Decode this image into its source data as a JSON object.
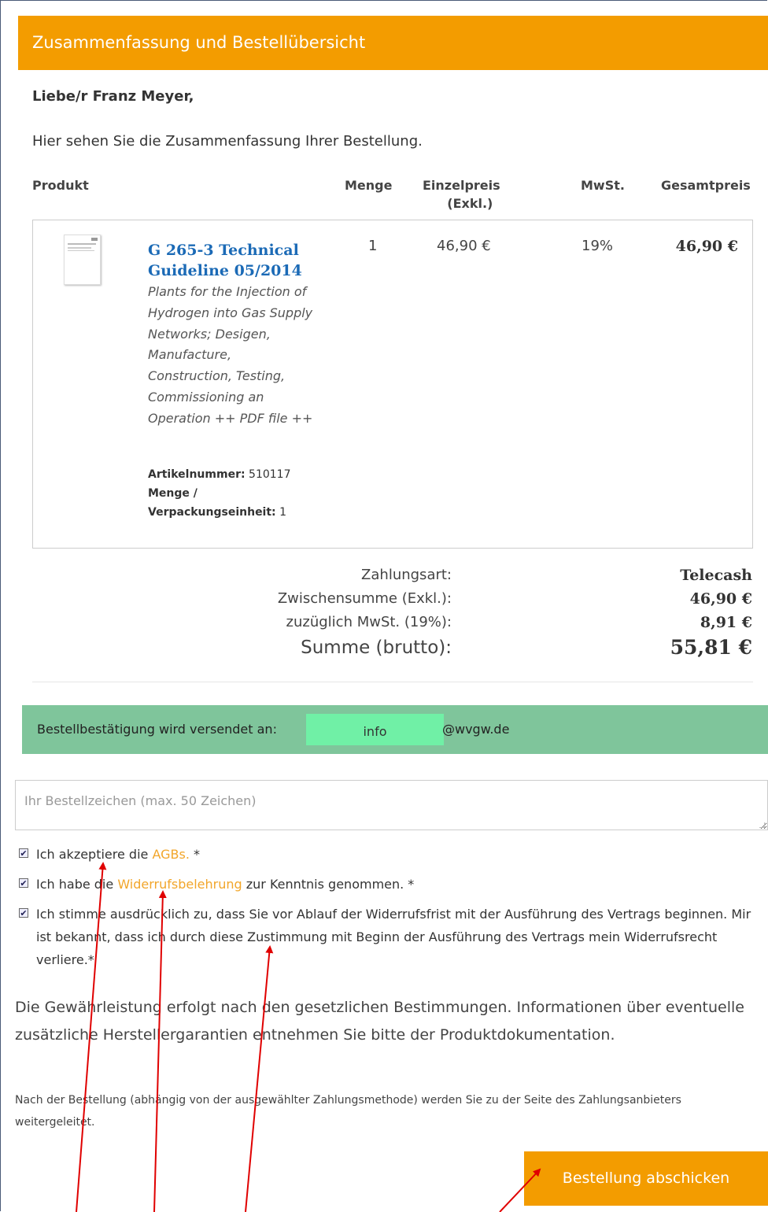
{
  "header": {
    "title": "Zusammenfassung und Bestellübersicht"
  },
  "greeting": "Liebe/r Franz Meyer,",
  "intro": "Hier sehen Sie die Zusammenfassung Ihrer Bestellung.",
  "table": {
    "col_product": "Produkt",
    "col_qty": "Menge",
    "col_unit": "Einzelpreis",
    "col_unit_sub": "(Exkl.)",
    "col_vat": "MwSt.",
    "col_total": "Gesamtpreis"
  },
  "item": {
    "name": "G 265-3 Technical Guideline 05/2014",
    "description": "Plants for the Injection of Hydrogen into Gas Supply Networks; Desigen, Manufacture, Construction, Testing, Commissioning an Operation ++ PDF file ++",
    "article_label": "Artikelnummer:",
    "article_value": "510117",
    "pack_label": "Menge / Verpackungseinheit:",
    "pack_value": "1",
    "qty": "1",
    "unit_price": "46,90 €",
    "vat": "19%",
    "total": "46,90 €"
  },
  "summary": {
    "payment_label": "Zahlungsart:",
    "payment_value": "Telecash",
    "subtotal_label": "Zwischensumme (Exkl.):",
    "subtotal_value": "46,90 €",
    "vat_label": "zuzüglich MwSt. (19%):",
    "vat_value": "8,91 €",
    "gross_label": "Summe (brutto):",
    "gross_value": "55,81 €"
  },
  "confirmation": {
    "label": "Bestellbestätigung wird versendet an:",
    "email_user": "info",
    "email_domain": "@wvgw.de"
  },
  "reference": {
    "placeholder": "Ihr Bestellzeichen (max. 50 Zeichen)"
  },
  "checks": {
    "agb_pre": "Ich akzeptiere die ",
    "agb_link": "AGBs.",
    "agb_post": " *",
    "revoke_pre": "Ich habe die ",
    "revoke_link": "Widerrufsbelehrung",
    "revoke_post": " zur Kenntnis genommen. *",
    "consent": "Ich stimme ausdrücklich zu, dass Sie vor Ablauf der Widerrufsfrist mit der Ausführung des Vertrags beginnen. Mir ist bekannt, dass ich durch diese Zustimmung mit Beginn der Ausführung des Vertrags mein Widerrufsrecht verliere.*",
    "mark": "✔"
  },
  "warranty": "Die Gewährleistung erfolgt nach den gesetzlichen Bestimmungen. Informationen über eventuelle zusätzliche Herstellergarantien entnehmen Sie bitte der Produktdokumentation.",
  "note": "Nach der Bestellung (abhängig von der ausgewählter Zahlungsmethode) werden Sie zu der Seite des Zahlungsanbieters weitergeleitet.",
  "submit_label": "Bestellung abschicken",
  "colors": {
    "accent": "#f39c00",
    "confirm_bar": "#7fc59b",
    "link": "#f2a62b",
    "product_link": "#1b6ab6",
    "annotation": "#e00000"
  }
}
